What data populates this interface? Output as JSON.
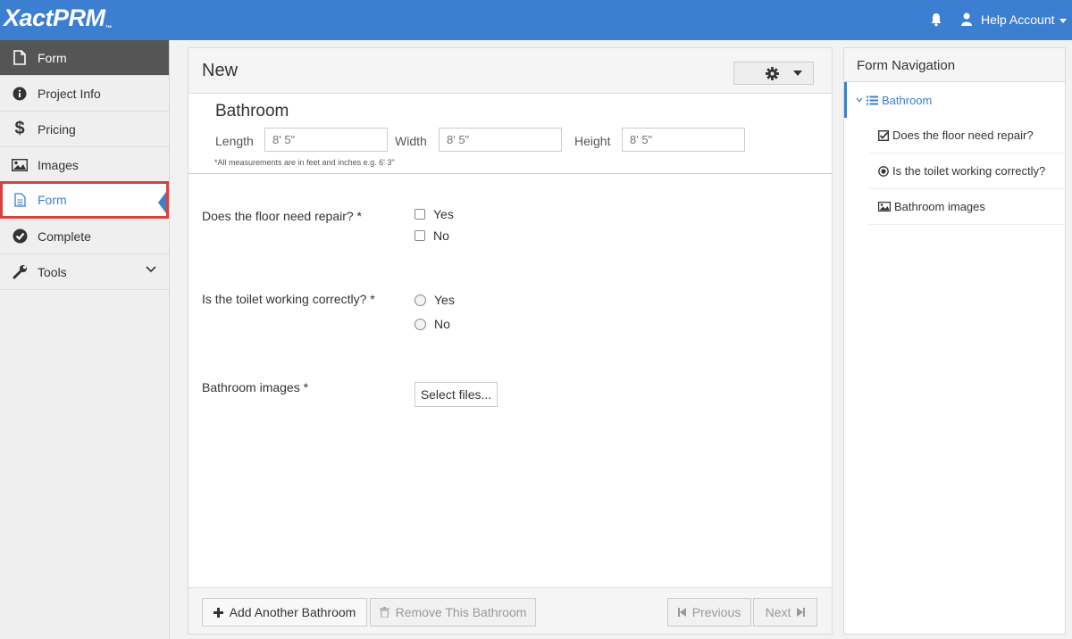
{
  "topbar": {
    "logo": "XactPRM",
    "logo_tm": "™",
    "account_label": "Help Account"
  },
  "sidebar": {
    "header_label": "Form",
    "items": [
      {
        "label": "Project Info",
        "icon": "info-circle-icon"
      },
      {
        "label": "Pricing",
        "icon": "dollar-icon"
      },
      {
        "label": "Images",
        "icon": "image-icon"
      },
      {
        "label": "Form",
        "icon": "document-icon",
        "active": true
      },
      {
        "label": "Complete",
        "icon": "check-circle-icon"
      },
      {
        "label": "Tools",
        "icon": "wrench-icon"
      }
    ]
  },
  "panel": {
    "title": "New",
    "section_title": "Bathroom",
    "dimensions": [
      {
        "label": "Length",
        "placeholder": "8' 5\""
      },
      {
        "label": "Width",
        "placeholder": "8' 5\""
      },
      {
        "label": "Height",
        "placeholder": "8' 5\""
      }
    ],
    "measure_note": "*All measurements are in feet and inches e.g. 6' 3\"",
    "questions": [
      {
        "label": "Does the floor need repair? *",
        "type": "checkbox",
        "options": [
          "Yes",
          "No"
        ]
      },
      {
        "label": "Is the toilet working correctly? *",
        "type": "radio",
        "options": [
          "Yes",
          "No"
        ]
      },
      {
        "label": "Bathroom images *",
        "type": "file",
        "button": "Select files..."
      }
    ],
    "footer": {
      "add_label": "Add Another Bathroom",
      "remove_label": "Remove This Bathroom",
      "prev_label": "Previous",
      "next_label": "Next"
    }
  },
  "form_nav": {
    "title": "Form Navigation",
    "root": "Bathroom",
    "items": [
      {
        "label": "Does the floor need repair?",
        "icon": "checkbox-icon"
      },
      {
        "label": "Is the toilet working correctly?",
        "icon": "radio-icon"
      },
      {
        "label": "Bathroom images",
        "icon": "image-icon"
      }
    ]
  },
  "colors": {
    "accent": "#3c7fd1",
    "active_border": "#d9413b",
    "sidebar_header": "#555555"
  }
}
